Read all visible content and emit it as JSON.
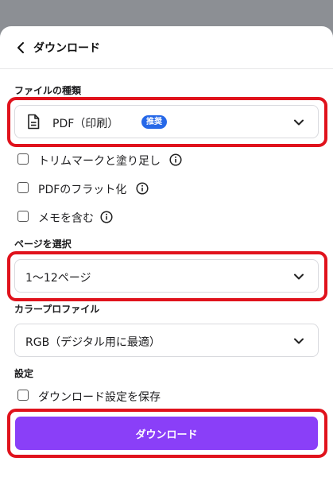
{
  "header": {
    "title": "ダウンロード"
  },
  "file_type": {
    "label": "ファイルの種類",
    "value": "PDF（印刷）",
    "badge": "推奨"
  },
  "options": [
    {
      "label": "トリムマークと塗り足し",
      "checked": false,
      "info": true
    },
    {
      "label": "PDFのフラット化",
      "checked": false,
      "info": true
    },
    {
      "label": "メモを含む",
      "checked": false,
      "info": true
    }
  ],
  "pages": {
    "label": "ページを選択",
    "value": "1〜12ページ"
  },
  "color_profile": {
    "label": "カラープロファイル",
    "value": "RGB（デジタル用に最適）"
  },
  "settings": {
    "label": "設定",
    "save_label": "ダウンロード設定を保存"
  },
  "download_button": {
    "label": "ダウンロード"
  },
  "colors": {
    "accent": "#8a3ff8",
    "badge": "#2668e8",
    "highlight": "#e0121c"
  },
  "icons": {
    "back": "chevron-left-icon",
    "file": "document-icon",
    "dropdown": "chevron-down-icon",
    "info": "info-icon"
  }
}
